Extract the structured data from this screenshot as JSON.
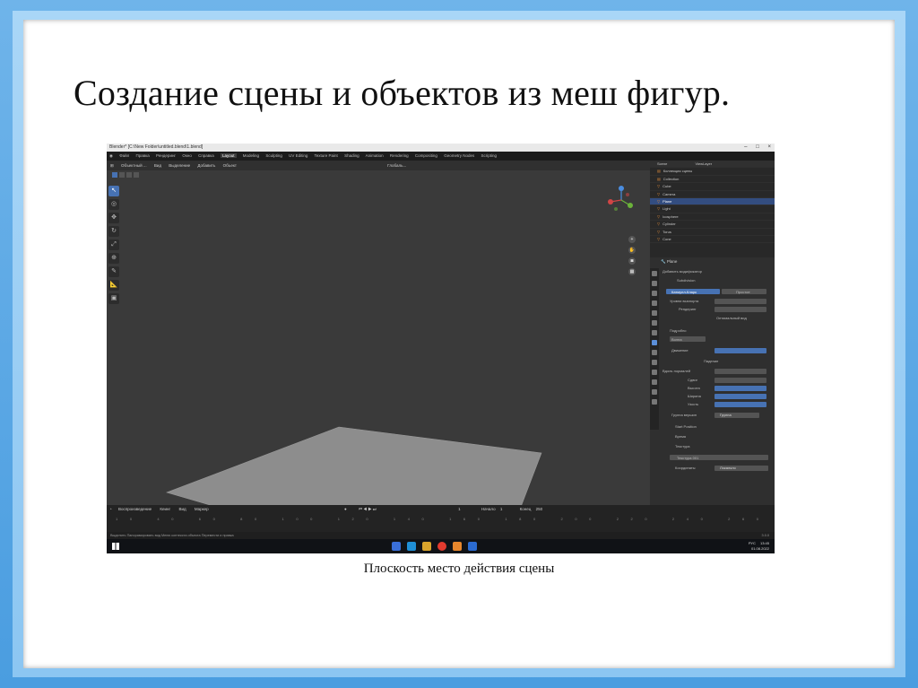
{
  "slide": {
    "title": "Создание сцены и объектов из меш фигур.",
    "caption": "Плоскость место действия сцены"
  },
  "blender": {
    "window_title": "Blender* [C:\\New Folder\\untitled.blend\\1.blend]",
    "menu": [
      "Файл",
      "Правка",
      "Рендеринг",
      "Окно",
      "Справка"
    ],
    "workspaces": [
      "Layout",
      "Modeling",
      "Sculpting",
      "UV Editing",
      "Texture Paint",
      "Shading",
      "Animation",
      "Rendering",
      "Compositing",
      "Geometry Nodes",
      "Scripting"
    ],
    "active_workspace": "Layout",
    "viewport_header": [
      "Объектный ...",
      "Вид",
      "Выделение",
      "Добавить",
      "Объект"
    ],
    "transform_orientation": "Глобаль...",
    "scene_label": "Scene",
    "view_layer_label": "ViewLayer",
    "outliner_rows": [
      "Коллекция сцены",
      "Collection",
      "Cube",
      "Camera",
      "Plane",
      "Light",
      "Icosphere",
      "Cylinder",
      "Torus",
      "Cone"
    ],
    "outliner_selected_index": 4,
    "props": {
      "header_object": "Plane",
      "modifier_panel": "Добавить модификатор",
      "mod1_name": "Subdivision",
      "mod1_tabs": [
        "Катмулл-Кларк",
        "Простое"
      ],
      "mod1_rows": [
        "Уровни вьюпорта",
        "Рендеринг",
        "Оптимальный вид"
      ],
      "section_advanced": "Подробно",
      "mod2_name": "Волна",
      "mod2_rows": [
        "Движение",
        "Падение",
        "Вдоль нормалей",
        "Сдвиг",
        "Высота",
        "Ширина",
        "Узость",
        "Группа вершин"
      ],
      "vertex_group_value": "Группа",
      "subsections": [
        "Start Position",
        "Время",
        "Текстура"
      ],
      "texture_value": "Текстура 001",
      "coordinates_label": "Координаты",
      "coordinates_value": "Локально"
    },
    "timeline": {
      "labels": [
        "Воспроизведение",
        "Кеинг",
        "Вид",
        "Маркер"
      ],
      "start_label": "Начало",
      "start_value": "1",
      "end_label": "Конец",
      "end_value": "250",
      "current_frame": "1",
      "ruler": [
        "10",
        "40",
        "60",
        "80",
        "100",
        "120",
        "140",
        "160",
        "180",
        "200",
        "220",
        "240",
        "260",
        "280",
        "300"
      ]
    },
    "status_bar": "Выделить    Панорамировать вид    Меню контекста объекта        Перемести и правка",
    "version": "3.0.0",
    "clock_time": "13:45",
    "clock_date": "01.08.2022",
    "lang": "РУС",
    "colors": {
      "viewport_bg": "#3a3a3a",
      "plane": "#8d8d8d",
      "accent_blue": "#4772b3"
    }
  }
}
